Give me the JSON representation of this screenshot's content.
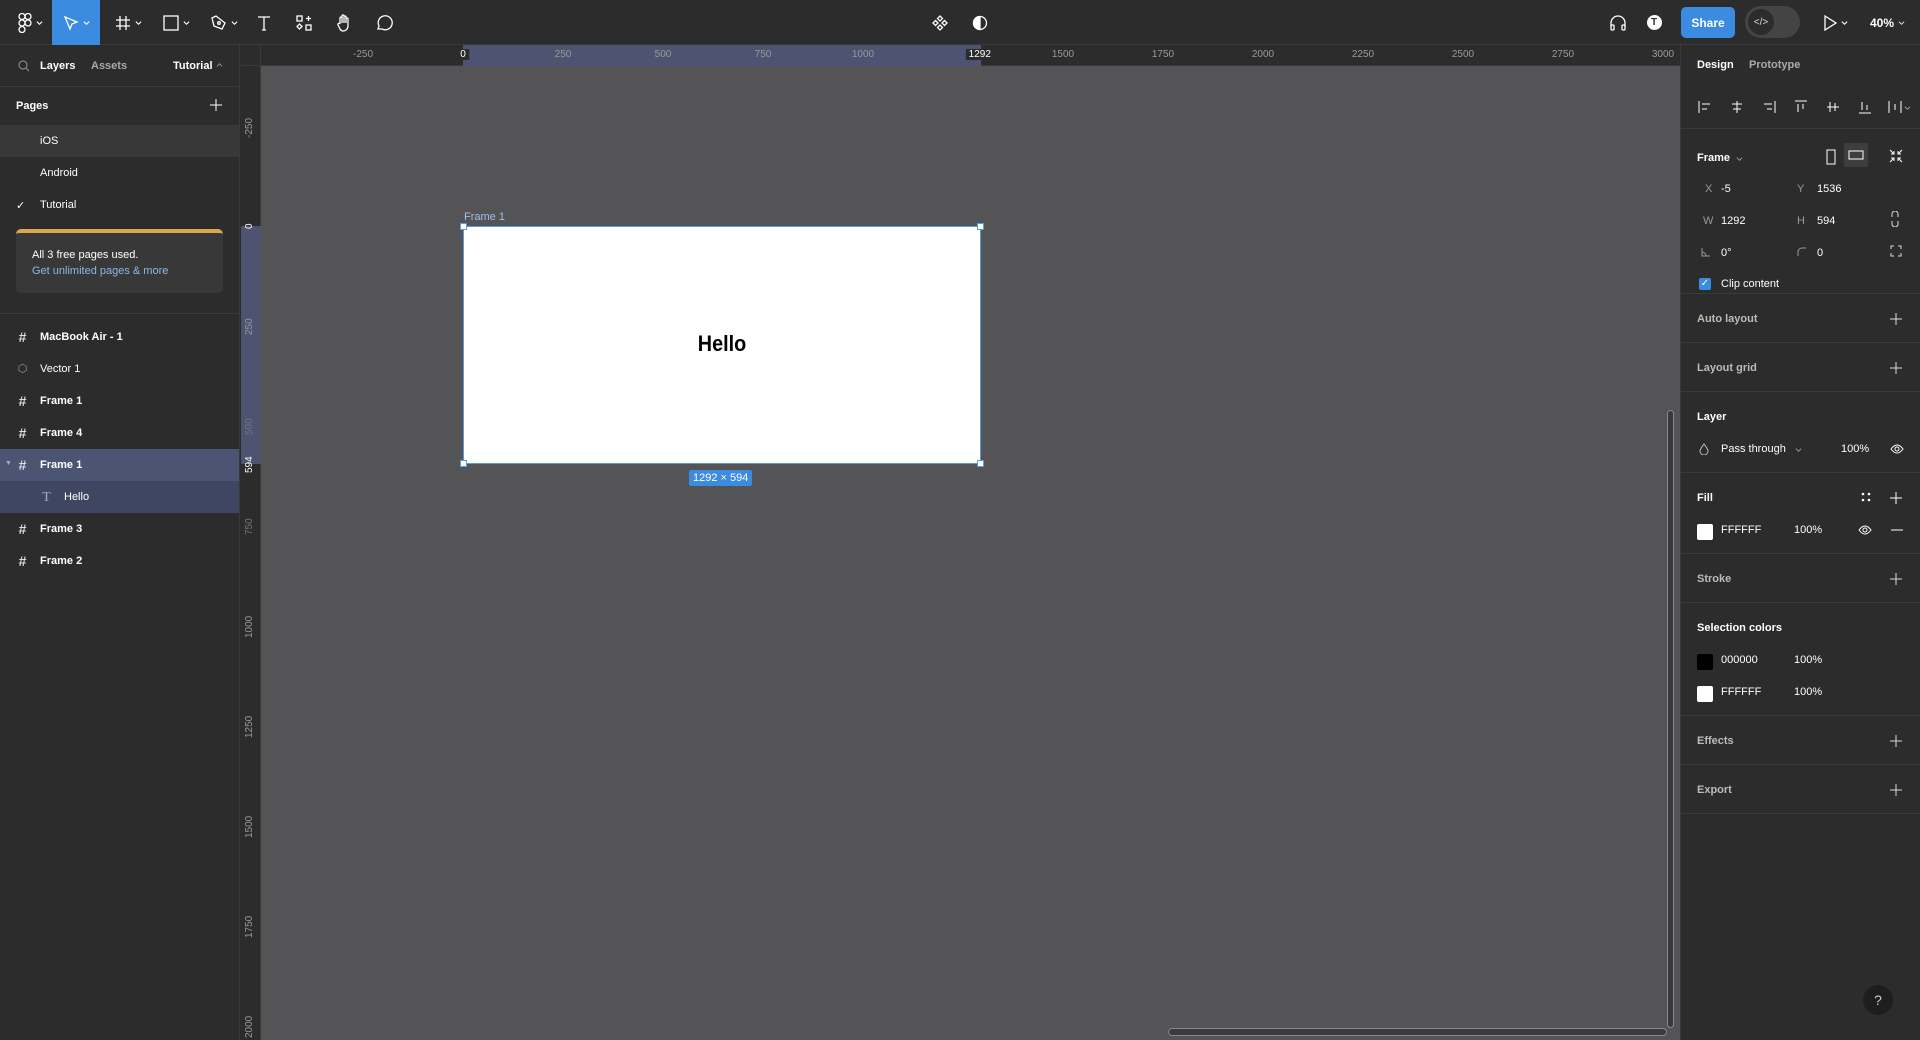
{
  "toolbar": {
    "tools": [
      {
        "name": "main-menu",
        "icon": "figma-logo-icon"
      },
      {
        "name": "move-tool",
        "icon": "cursor-arrow-icon",
        "active": true
      },
      {
        "name": "frame-tool",
        "icon": "frame-hash-icon"
      },
      {
        "name": "shape-tool",
        "icon": "rectangle-icon"
      },
      {
        "name": "pen-tool",
        "icon": "pen-icon"
      },
      {
        "name": "text-tool",
        "icon": "text-t-icon"
      },
      {
        "name": "resources-tool",
        "icon": "resources-icon"
      },
      {
        "name": "hand-tool",
        "icon": "hand-icon"
      },
      {
        "name": "comment-tool",
        "icon": "comment-bubble-icon"
      }
    ],
    "share_label": "Share",
    "zoom_level": "40%",
    "accent_color": "#3b8be0"
  },
  "left_panel": {
    "tabs": {
      "layers": "Layers",
      "assets": "Assets",
      "page_switcher": "Tutorial"
    },
    "pages_title": "Pages",
    "pages": [
      {
        "label": "iOS",
        "current": false
      },
      {
        "label": "Android",
        "current": false
      },
      {
        "label": "Tutorial",
        "current": true
      }
    ],
    "upsell": {
      "text": "All 3 free pages used.",
      "link": "Get unlimited pages & more"
    },
    "layers": [
      {
        "label": "MacBook Air - 1",
        "type": "frame"
      },
      {
        "label": "Vector 1",
        "type": "vector"
      },
      {
        "label": "Frame 1",
        "type": "frame"
      },
      {
        "label": "Frame 4",
        "type": "frame"
      },
      {
        "label": "Frame 1",
        "type": "frame",
        "selected": true,
        "expanded": true
      },
      {
        "label": "Hello",
        "type": "text",
        "child": true
      },
      {
        "label": "Frame 3",
        "type": "frame"
      },
      {
        "label": "Frame 2",
        "type": "frame"
      }
    ]
  },
  "rulers": {
    "horizontal": [
      "-250",
      "0",
      "250",
      "500",
      "750",
      "1000",
      "1292",
      "1500",
      "1750",
      "2000",
      "2250",
      "2500",
      "2750",
      "3000"
    ],
    "vertical": [
      "-250",
      "0",
      "250",
      "500",
      "594",
      "750",
      "1000",
      "1250",
      "1500",
      "1750",
      "2000"
    ]
  },
  "canvas": {
    "frame_label": "Frame 1",
    "frame_text": "Hello",
    "size_badge": "1292 × 594"
  },
  "right_panel": {
    "tabs": {
      "design": "Design",
      "prototype": "Prototype"
    },
    "frame": {
      "title": "Frame",
      "x_label": "X",
      "x": "-5",
      "y_label": "Y",
      "y": "1536",
      "w_label": "W",
      "w": "1292",
      "h_label": "H",
      "h": "594",
      "rotation": "0°",
      "radius": "0",
      "clip_content": "Clip content"
    },
    "auto_layout": "Auto layout",
    "layout_grid": "Layout grid",
    "layer": {
      "title": "Layer",
      "blend": "Pass through",
      "opacity": "100%"
    },
    "fill": {
      "title": "Fill",
      "hex": "FFFFFF",
      "opacity": "100%",
      "color": "#ffffff"
    },
    "stroke": "Stroke",
    "selection_colors": {
      "title": "Selection colors",
      "items": [
        {
          "hex": "000000",
          "opacity": "100%",
          "color": "#000000"
        },
        {
          "hex": "FFFFFF",
          "opacity": "100%",
          "color": "#ffffff"
        }
      ]
    },
    "effects": "Effects",
    "export": "Export"
  },
  "help_label": "?"
}
